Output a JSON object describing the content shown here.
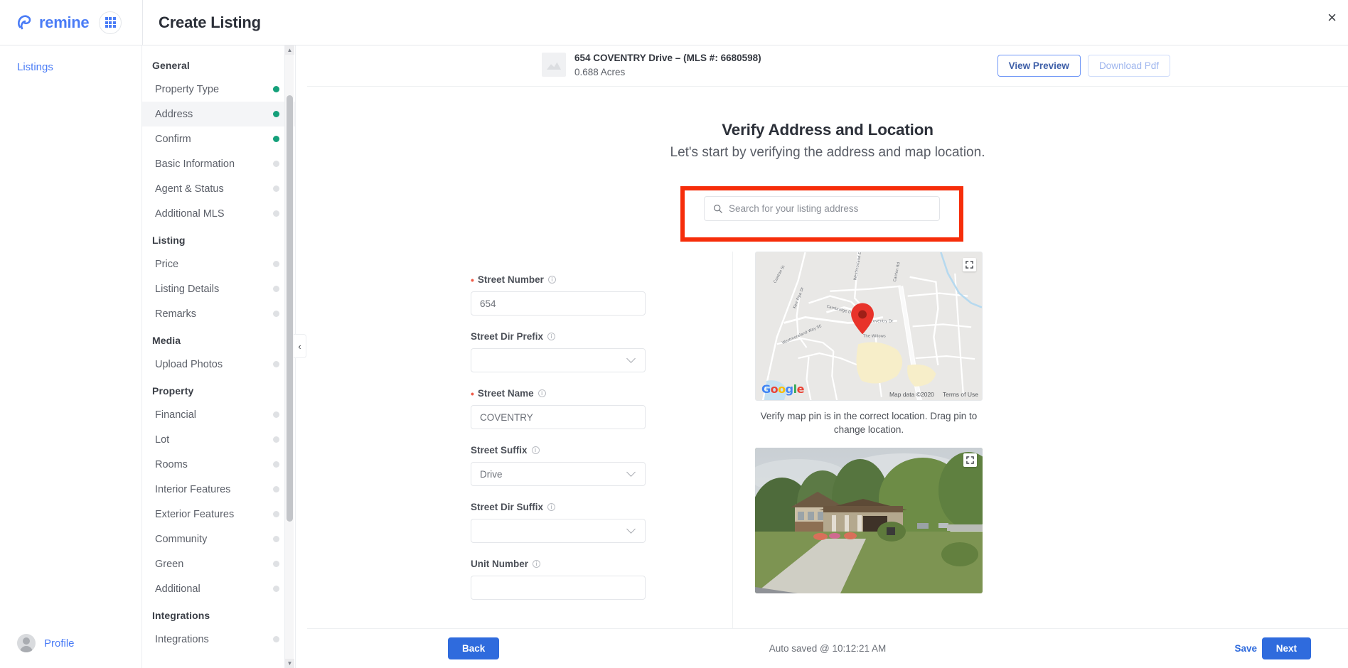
{
  "topbar": {
    "brand": "remine",
    "grid_icon": "apps-grid-icon",
    "title": "Create Listing",
    "close_icon": "×"
  },
  "leftrail": {
    "link": "Listings",
    "profile": "Profile"
  },
  "stepnav": {
    "sections": [
      {
        "title": "General",
        "items": [
          {
            "label": "Property Type",
            "status": "done"
          },
          {
            "label": "Address",
            "status": "done",
            "active": true
          },
          {
            "label": "Confirm",
            "status": "done"
          },
          {
            "label": "Basic Information",
            "status": "pending"
          },
          {
            "label": "Agent & Status",
            "status": "pending"
          },
          {
            "label": "Additional MLS",
            "status": "pending"
          }
        ]
      },
      {
        "title": "Listing",
        "items": [
          {
            "label": "Price",
            "status": "pending"
          },
          {
            "label": "Listing Details",
            "status": "pending"
          },
          {
            "label": "Remarks",
            "status": "pending"
          }
        ]
      },
      {
        "title": "Media",
        "items": [
          {
            "label": "Upload Photos",
            "status": "pending"
          }
        ]
      },
      {
        "title": "Property",
        "items": [
          {
            "label": "Financial",
            "status": "pending"
          },
          {
            "label": "Lot",
            "status": "pending"
          },
          {
            "label": "Rooms",
            "status": "pending"
          },
          {
            "label": "Interior Features",
            "status": "pending"
          },
          {
            "label": "Exterior Features",
            "status": "pending"
          },
          {
            "label": "Community",
            "status": "pending"
          },
          {
            "label": "Green",
            "status": "pending"
          },
          {
            "label": "Additional",
            "status": "pending"
          }
        ]
      },
      {
        "title": "Integrations",
        "items": [
          {
            "label": "Integrations",
            "status": "pending"
          }
        ]
      }
    ],
    "collapse_icon": "‹"
  },
  "listing_header": {
    "address": "654 COVENTRY Drive – (MLS #: 6680598)",
    "acres": "0.688 Acres",
    "view_preview": "View Preview",
    "download_pdf": "Download Pdf"
  },
  "headline": {
    "title": "Verify Address and Location",
    "subtitle": "Let's start by verifying the address and map location."
  },
  "search": {
    "placeholder": "Search for your listing address",
    "value": "",
    "highlight_color": "#f62d0a"
  },
  "form": {
    "fields": [
      {
        "label": "Street Number",
        "required": true,
        "type": "input",
        "value": "654"
      },
      {
        "label": "Street Dir Prefix",
        "required": false,
        "type": "select",
        "value": ""
      },
      {
        "label": "Street Name",
        "required": true,
        "type": "input",
        "value": "COVENTRY"
      },
      {
        "label": "Street Suffix",
        "required": false,
        "type": "select",
        "value": "Drive"
      },
      {
        "label": "Street Dir Suffix",
        "required": false,
        "type": "select",
        "value": ""
      },
      {
        "label": "Unit Number",
        "required": false,
        "type": "input",
        "value": ""
      }
    ]
  },
  "map": {
    "caption": "Verify map pin is in the correct location. Drag pin to change location.",
    "attribution": "Map data ©2020",
    "terms": "Terms of Use",
    "provider": "Google",
    "pin_color": "#e8332a",
    "labels": [
      "Cawton St",
      "Westmorland Dr",
      "Canton Rd",
      "Cambridge Dr",
      "Coventry Dr",
      "The Willows",
      "Westmoreland Way SE",
      "Kerr Pipe Dr"
    ]
  },
  "bottombar": {
    "back": "Back",
    "status": "Auto saved @ 10:12:21 AM",
    "save": "Save",
    "next": "Next"
  },
  "colors": {
    "brand_blue": "#4a7cf6",
    "action_blue": "#2f6bdd",
    "done_green": "#14a07a",
    "required_red": "#ef5b48"
  }
}
